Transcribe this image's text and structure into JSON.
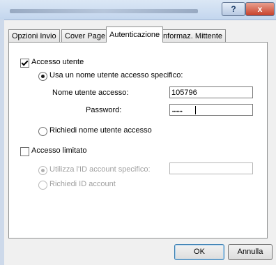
{
  "window": {
    "help_label": "?",
    "close_label": "x"
  },
  "tabs": [
    {
      "label": "Opzioni Invio"
    },
    {
      "label": "Cover Page"
    },
    {
      "label": "Autenticazione"
    },
    {
      "label": "Informaz. Mittente"
    }
  ],
  "user_access": {
    "checkbox_label": "Accesso utente",
    "checked": true,
    "option_specific_label": "Usa un nome utente accesso specifico:",
    "username_label": "Nome utente accesso:",
    "username_value": "105796",
    "password_label": "Password:",
    "password_mask": "•••••••",
    "option_ask_label": "Richiedi nome utente accesso"
  },
  "limited_access": {
    "checkbox_label": "Accesso limitato",
    "checked": false,
    "option_account_id_label": "Utilizza l'ID account specifico:",
    "account_id_value": "",
    "option_ask_id_label": "Richiedi ID account"
  },
  "buttons": {
    "ok_label": "OK",
    "cancel_label": "Annulla"
  }
}
